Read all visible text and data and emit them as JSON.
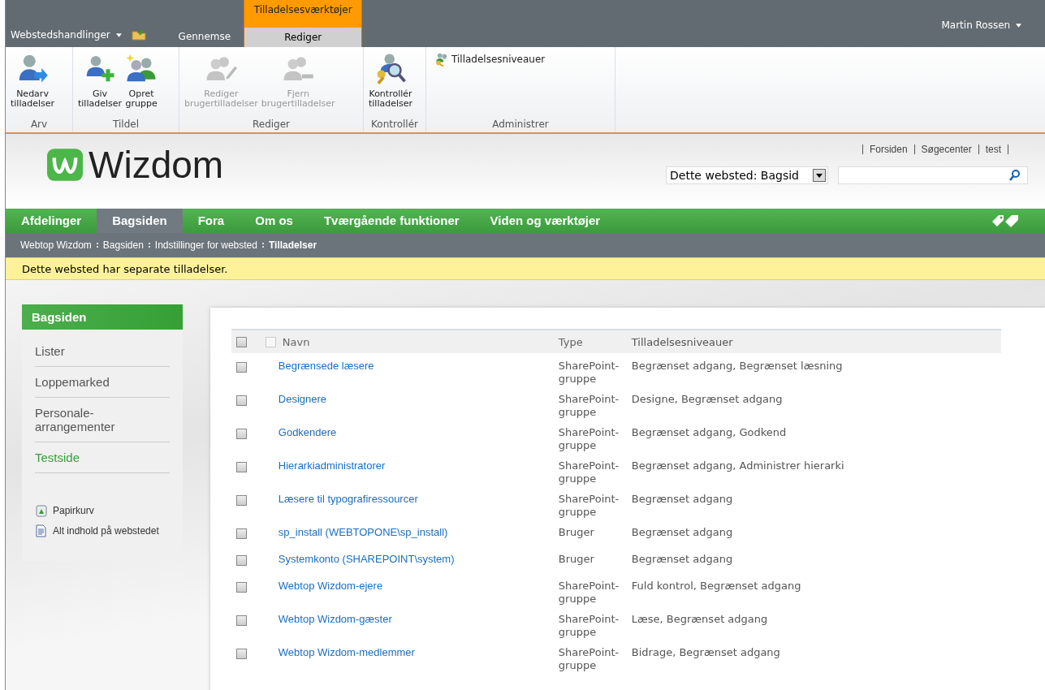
{
  "ribbon": {
    "site_actions": "Webstedshandlinger",
    "tabs": [
      {
        "label": "Gennemse",
        "selected": false
      },
      {
        "label": "Rediger",
        "selected": true
      }
    ],
    "contextual_group": "Tilladelsesværktøjer",
    "user": "Martin Rossen",
    "groups": [
      {
        "label": "Arv",
        "buttons": [
          {
            "kind": "inherit",
            "label": "Nedarv tilladelser",
            "disabled": false
          }
        ]
      },
      {
        "label": "Tildel",
        "buttons": [
          {
            "kind": "grant",
            "label": "Giv tilladelser",
            "disabled": false
          },
          {
            "kind": "group",
            "label": "Opret gruppe",
            "disabled": false
          }
        ]
      },
      {
        "label": "Rediger",
        "buttons": [
          {
            "kind": "edit",
            "label": "Rediger brugertilladelser",
            "disabled": true
          },
          {
            "kind": "remove",
            "label": "Fjern brugertilladelser",
            "disabled": true
          }
        ]
      },
      {
        "label": "Kontrollér",
        "buttons": [
          {
            "kind": "check",
            "label": "Kontrollér tilladelser",
            "disabled": false
          }
        ]
      },
      {
        "label": "Administrer",
        "buttons": [
          {
            "kind": "levels",
            "label": "Tilladelsesniveauer",
            "disabled": false
          }
        ]
      }
    ]
  },
  "header": {
    "logo": "Wizdom",
    "links": [
      "Forsiden",
      "Søgecenter",
      "test"
    ],
    "search_scope": "Dette websted: Bagsid"
  },
  "nav": [
    {
      "label": "Afdelinger",
      "selected": false
    },
    {
      "label": "Bagsiden",
      "selected": true
    },
    {
      "label": "Fora",
      "selected": false
    },
    {
      "label": "Om os",
      "selected": false
    },
    {
      "label": "Tværgående funktioner",
      "selected": false
    },
    {
      "label": "Viden og værktøjer",
      "selected": false
    }
  ],
  "breadcrumb": [
    "Webtop Wizdom",
    "Bagsiden",
    "Indstillinger for websted",
    "Tilladelser"
  ],
  "status": "Dette websted har separate tilladelser.",
  "sidebar": {
    "title": "Bagsiden",
    "items": [
      {
        "label": "Lister",
        "selected": false
      },
      {
        "label": "Loppemarked",
        "selected": false
      },
      {
        "label": "Personale-arrangementer",
        "selected": false
      },
      {
        "label": "Testside",
        "selected": true
      }
    ],
    "links": [
      {
        "kind": "recycle",
        "label": "Papirkurv"
      },
      {
        "kind": "content",
        "label": "Alt indhold på webstedet"
      }
    ]
  },
  "table": {
    "columns": [
      "Navn",
      "Type",
      "Tilladelsesniveauer"
    ],
    "select_all": false,
    "rows": [
      {
        "name": "Begrænsede læsere",
        "type": "SharePoint-gruppe",
        "levels": "Begrænset adgang, Begrænset læsning",
        "checked": false
      },
      {
        "name": "Designere",
        "type": "SharePoint-gruppe",
        "levels": "Designe, Begrænset adgang",
        "checked": false
      },
      {
        "name": "Godkendere",
        "type": "SharePoint-gruppe",
        "levels": "Begrænset adgang, Godkend",
        "checked": false
      },
      {
        "name": "Hierarkiadministratorer",
        "type": "SharePoint-gruppe",
        "levels": "Begrænset adgang, Administrer hierarki",
        "checked": false
      },
      {
        "name": "Læsere til typografiressourcer",
        "type": "SharePoint-gruppe",
        "levels": "Begrænset adgang",
        "checked": false
      },
      {
        "name": "sp_install (WEBTOPONE\\sp_install)",
        "type": "Bruger",
        "levels": "Begrænset adgang",
        "checked": false
      },
      {
        "name": "Systemkonto (SHAREPOINT\\system)",
        "type": "Bruger",
        "levels": "Begrænset adgang",
        "checked": false
      },
      {
        "name": "Webtop Wizdom-ejere",
        "type": "SharePoint-gruppe",
        "levels": "Fuld kontrol, Begrænset adgang",
        "checked": false
      },
      {
        "name": "Webtop Wizdom-gæster",
        "type": "SharePoint-gruppe",
        "levels": "Læse, Begrænset adgang",
        "checked": false
      },
      {
        "name": "Webtop Wizdom-medlemmer",
        "type": "SharePoint-gruppe",
        "levels": "Bidrage, Begrænset adgang",
        "checked": false
      }
    ]
  }
}
